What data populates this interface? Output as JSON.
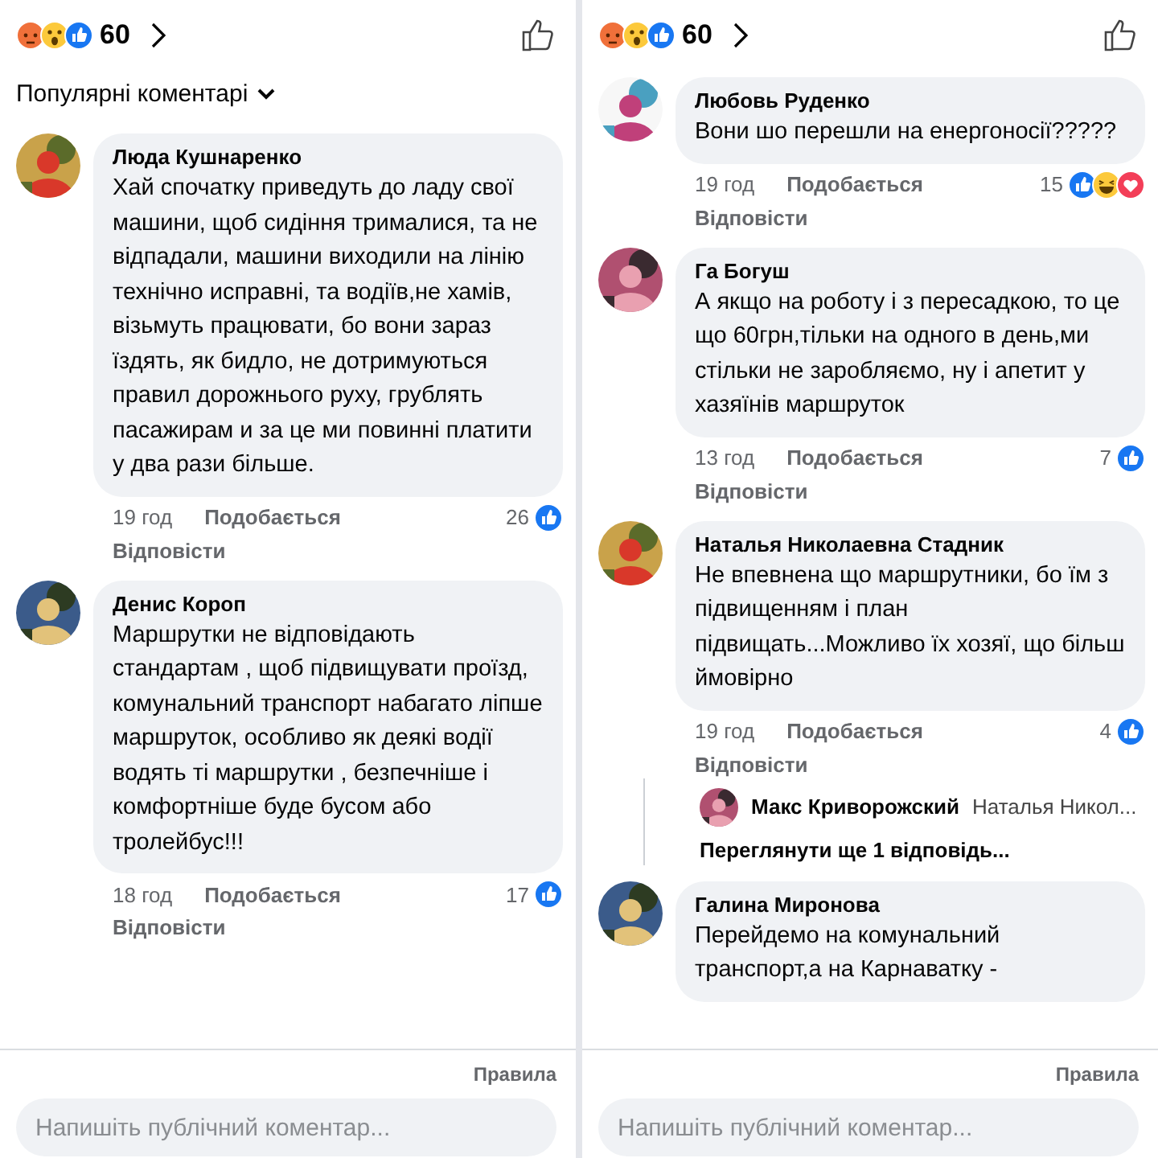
{
  "panels": [
    {
      "header": {
        "reactions": [
          {
            "kind": "angry"
          },
          {
            "kind": "wow"
          },
          {
            "kind": "like"
          }
        ],
        "count": "60"
      },
      "sort": {
        "label": "Популярні коментарі"
      },
      "comments": [
        {
          "author": "Люда Кушнаренко",
          "text": "Хай спочатку приведуть до ладу свої машини, щоб сидіння трималися, та не відпадали, машини виходили на лінію технічно исправні, та водіїв,не хамів, візьмуть працювати, бо вони зараз їздять, як бидло, не дотримуються правил дорожнього руху, грублять пасажирам и за це ми повинні платити у два рази більше.",
          "time": "19 год",
          "like_label": "Подобається",
          "reply_label": "Відповісти",
          "reaction_count": "26",
          "reactions": [
            {
              "kind": "like"
            }
          ]
        },
        {
          "author": "Денис Короп",
          "text": "Маршрутки не відповідають стандартам , щоб підвищувати проїзд, комунальний транспорт набагато ліпше маршруток, особливо як деякі водії водять ті маршрутки , безпечніше і комфортніше буде бусом або тролейбус!!!",
          "time": "18 год",
          "like_label": "Подобається",
          "reply_label": "Відповісти",
          "reaction_count": "17",
          "reactions": [
            {
              "kind": "like"
            }
          ]
        }
      ],
      "footer": {
        "rules": "Правила",
        "placeholder": "Напишіть публічний коментар..."
      }
    },
    {
      "header": {
        "reactions": [
          {
            "kind": "angry"
          },
          {
            "kind": "wow"
          },
          {
            "kind": "like"
          }
        ],
        "count": "60"
      },
      "comments": [
        {
          "author": "Любовь Руденко",
          "text": "Вони шо перешли на енергоносії?????",
          "time": "19 год",
          "like_label": "Подобається",
          "reply_label": "Відповісти",
          "reaction_count": "15",
          "reactions": [
            {
              "kind": "like"
            },
            {
              "kind": "haha"
            },
            {
              "kind": "love"
            }
          ]
        },
        {
          "author": "Га Богуш",
          "text": "А якщо на роботу і з пересадкою, то це що 60грн,тільки на одного в день,ми стільки не заробляємо, ну і апетит у хазяїнів маршруток",
          "time": "13 год",
          "like_label": "Подобається",
          "reply_label": "Відповісти",
          "reaction_count": "7",
          "reactions": [
            {
              "kind": "like"
            }
          ]
        },
        {
          "author": "Наталья Николаевна Стадник",
          "text": "Не впевнена що маршрутники,  бо їм з підвищенням і план підвищать...Можливо їх хозяї, що більш ймовірно",
          "time": "19 год",
          "like_label": "Подобається",
          "reply_label": "Відповісти",
          "reaction_count": "4",
          "reactions": [
            {
              "kind": "like"
            }
          ],
          "replies": [
            {
              "author": "Макс Криворожский",
              "text": "Наталья Никол..."
            }
          ],
          "more_replies": "Переглянути ще 1 відповідь..."
        },
        {
          "author": "Галина Миронова",
          "text": "Перейдемо на комунальний транспорт,а на Карнаватку -"
        }
      ],
      "footer": {
        "rules": "Правила",
        "placeholder": "Напишіть публічний коментар..."
      }
    }
  ]
}
